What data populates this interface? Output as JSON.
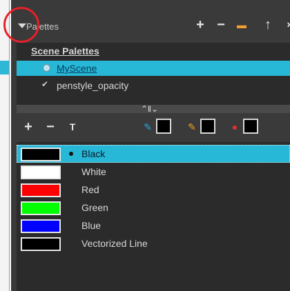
{
  "header": {
    "title": "Palettes",
    "buttons": [
      {
        "name": "add-palette",
        "glyph": "+"
      },
      {
        "name": "remove-palette",
        "glyph": "−"
      },
      {
        "name": "palette-browser",
        "glyph": "▬"
      },
      {
        "name": "move-up",
        "glyph": "↑"
      },
      {
        "name": "more",
        "glyph": "›"
      }
    ]
  },
  "palette_list": {
    "heading": "Scene Palettes",
    "items": [
      {
        "label": "MyScene",
        "selected": true,
        "marker": "radio"
      },
      {
        "label": "penstyle_opacity",
        "selected": false,
        "marker": "check"
      }
    ]
  },
  "splitter": {
    "grip": "⌃‖⌄"
  },
  "toolbar": {
    "add": "+",
    "remove": "−",
    "new_texture": "T",
    "tools": [
      {
        "icon": "brush-icon",
        "glyph": "✎",
        "color": "#2aa6e0"
      },
      {
        "icon": "pencil-icon",
        "glyph": "✎",
        "color": "#f0a020"
      },
      {
        "icon": "paint-bucket-icon",
        "glyph": "●",
        "color": "#e03030"
      }
    ]
  },
  "colors": [
    {
      "name": "Black",
      "hex": "#000000",
      "selected": true
    },
    {
      "name": "White",
      "hex": "#ffffff",
      "selected": false
    },
    {
      "name": "Red",
      "hex": "#ff0000",
      "selected": false
    },
    {
      "name": "Green",
      "hex": "#00ff00",
      "selected": false
    },
    {
      "name": "Blue",
      "hex": "#0000ff",
      "selected": false
    },
    {
      "name": "Vectorized Line",
      "hex": "#000000",
      "selected": false
    }
  ],
  "accent": {
    "selection": "#27b8d8",
    "highlight_ring": "#e8202a"
  }
}
